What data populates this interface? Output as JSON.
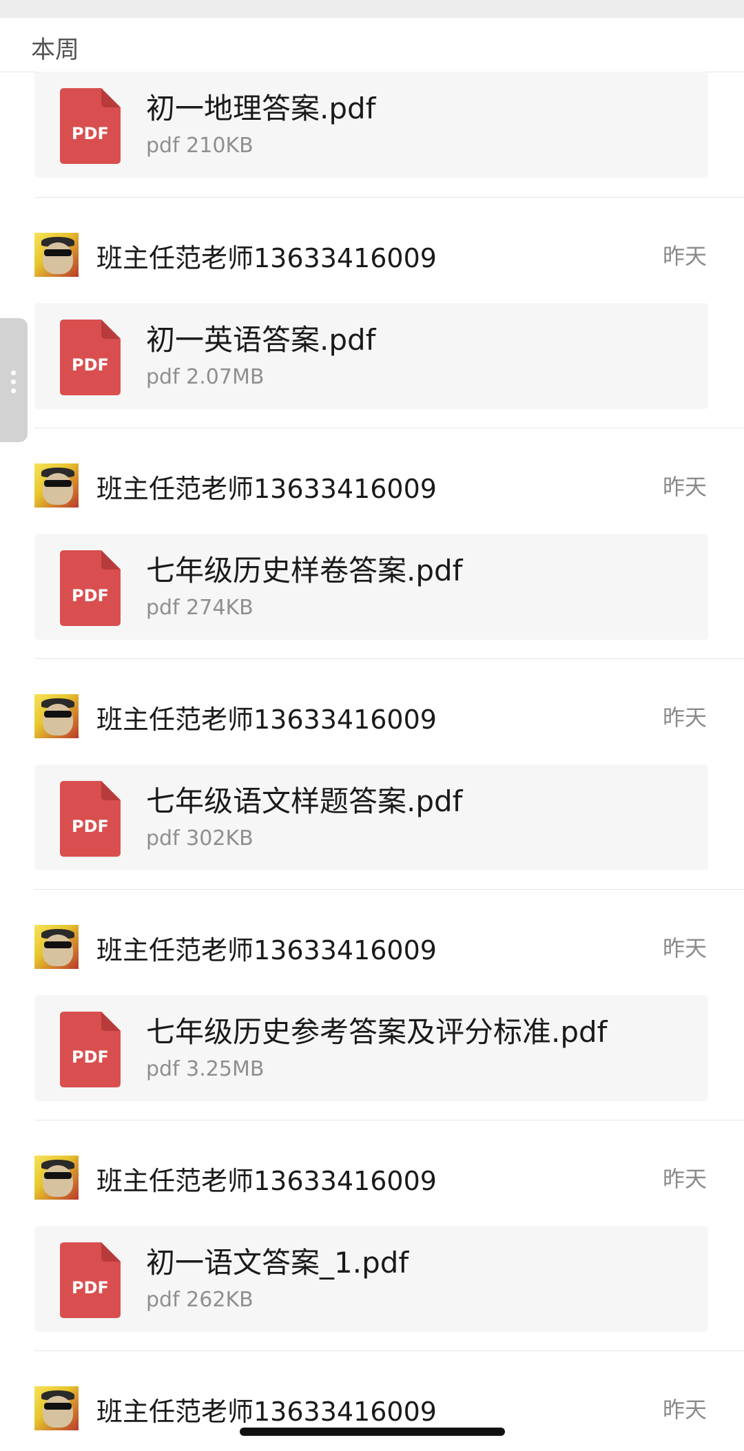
{
  "section": {
    "title": "本周"
  },
  "first_file": {
    "name": "初一地理答案.pdf",
    "meta": "pdf 210KB",
    "icon_label": "PDF"
  },
  "groups": [
    {
      "sender": "班主任范老师13633416009",
      "time": "昨天",
      "file": {
        "name": "初一英语答案.pdf",
        "meta": "pdf 2.07MB",
        "icon_label": "PDF"
      }
    },
    {
      "sender": "班主任范老师13633416009",
      "time": "昨天",
      "file": {
        "name": "七年级历史样卷答案.pdf",
        "meta": "pdf 274KB",
        "icon_label": "PDF"
      }
    },
    {
      "sender": "班主任范老师13633416009",
      "time": "昨天",
      "file": {
        "name": "七年级语文样题答案.pdf",
        "meta": "pdf 302KB",
        "icon_label": "PDF"
      }
    },
    {
      "sender": "班主任范老师13633416009",
      "time": "昨天",
      "file": {
        "name": "七年级历史参考答案及评分标准.pdf",
        "meta": "pdf 3.25MB",
        "icon_label": "PDF"
      }
    },
    {
      "sender": "班主任范老师13633416009",
      "time": "昨天",
      "file": {
        "name": "初一语文答案_1.pdf",
        "meta": "pdf 262KB",
        "icon_label": "PDF"
      }
    },
    {
      "sender": "班主任范老师13633416009",
      "time": "昨天"
    }
  ],
  "colors": {
    "pdf_red": "#d94f4f",
    "pdf_fold": "#b83b3b"
  }
}
